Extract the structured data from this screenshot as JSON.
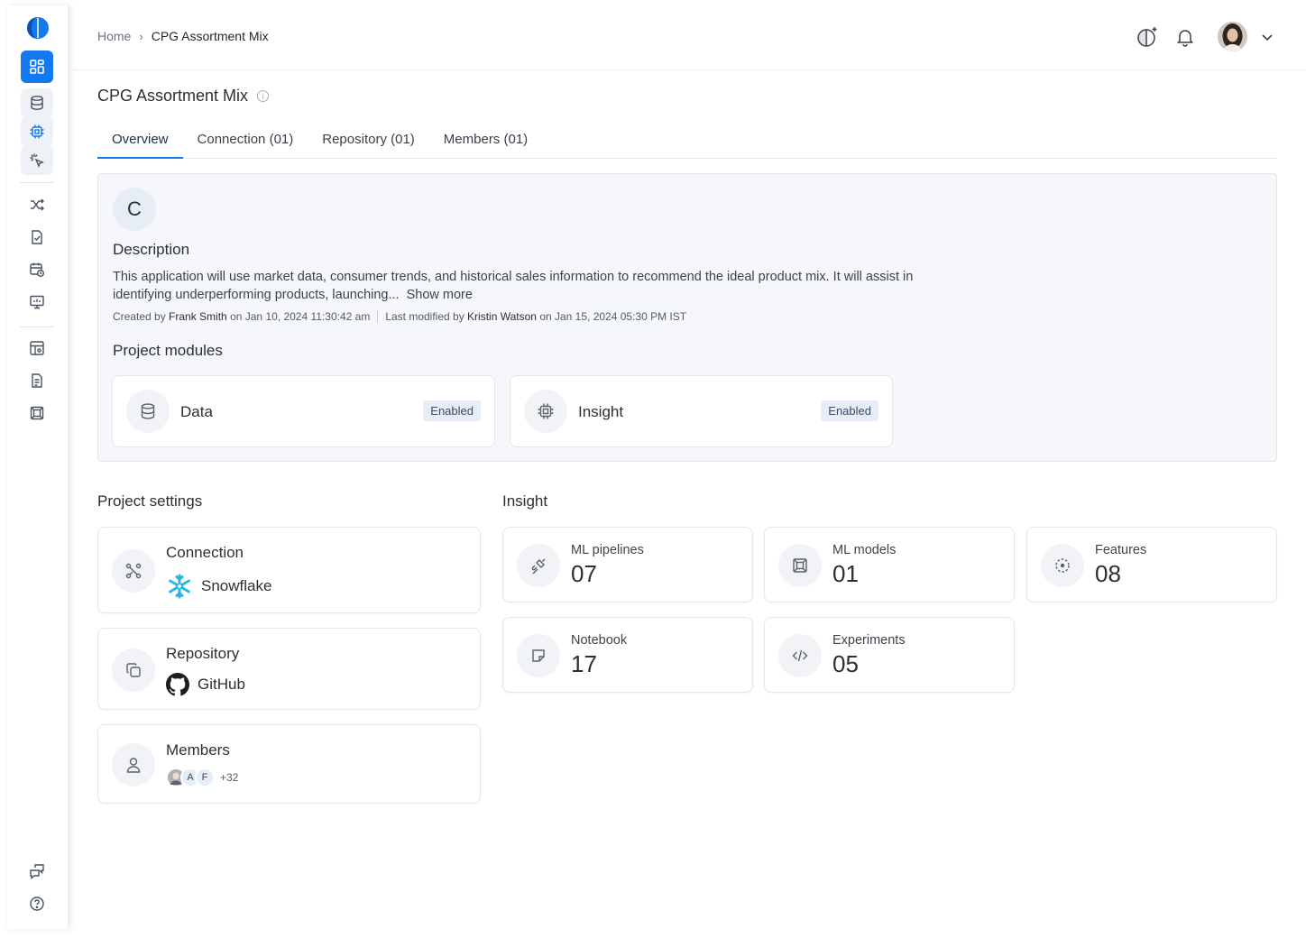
{
  "header": {
    "breadcrumb": {
      "home": "Home",
      "separator": "›",
      "current": "CPG Assortment Mix"
    },
    "icons": [
      "theme-toggle-icon",
      "bell-icon",
      "chevron-down-icon"
    ]
  },
  "sidebar": {
    "items": [
      "dashboard-icon",
      "database-icon",
      "chip-icon",
      "sparkle-cursor-icon",
      "shuffle-icon",
      "file-check-icon",
      "calendar-clock-icon",
      "presentation-icon",
      "table-settings-icon",
      "document-icon",
      "model-box-icon",
      "feedback-icon",
      "help-icon"
    ]
  },
  "page": {
    "title": "CPG Assortment Mix",
    "info_icon": "i",
    "tabs": [
      "Overview",
      "Connection (01)",
      "Repository (01)",
      "Members (01)"
    ]
  },
  "overview": {
    "avatar_letter": "C",
    "description_heading": "Description",
    "description": "This application will use market data, consumer trends, and historical sales information to recommend the ideal product mix. It will assist in identifying underperforming products, launching...",
    "show_more": "Show more",
    "created_prefix": "Created by",
    "created_by": "Frank Smith",
    "created_on": "on Jan 10, 2024 11:30:42 am",
    "modified_prefix": "Last modified by",
    "modified_by": "Kristin Watson",
    "modified_on": "on Jan 15, 2024 05:30 PM IST",
    "modules_heading": "Project modules",
    "modules": [
      {
        "name": "Data",
        "status": "Enabled"
      },
      {
        "name": "Insight",
        "status": "Enabled"
      }
    ]
  },
  "settings": {
    "heading": "Project settings",
    "connection": {
      "title": "Connection",
      "value": "Snowflake"
    },
    "repository": {
      "title": "Repository",
      "value": "GitHub"
    },
    "members": {
      "title": "Members",
      "initials": [
        "A",
        "F"
      ],
      "extra": "+32"
    }
  },
  "insight": {
    "heading": "Insight",
    "cards": [
      {
        "label": "ML pipelines",
        "value": "07"
      },
      {
        "label": "ML models",
        "value": "01"
      },
      {
        "label": "Features",
        "value": "08"
      },
      {
        "label": "Notebook",
        "value": "17"
      },
      {
        "label": "Experiments",
        "value": "05"
      }
    ]
  },
  "colors": {
    "accent": "#1478f0",
    "snowflake": "#29b5e8",
    "badge_bg": "#e6edf6"
  }
}
